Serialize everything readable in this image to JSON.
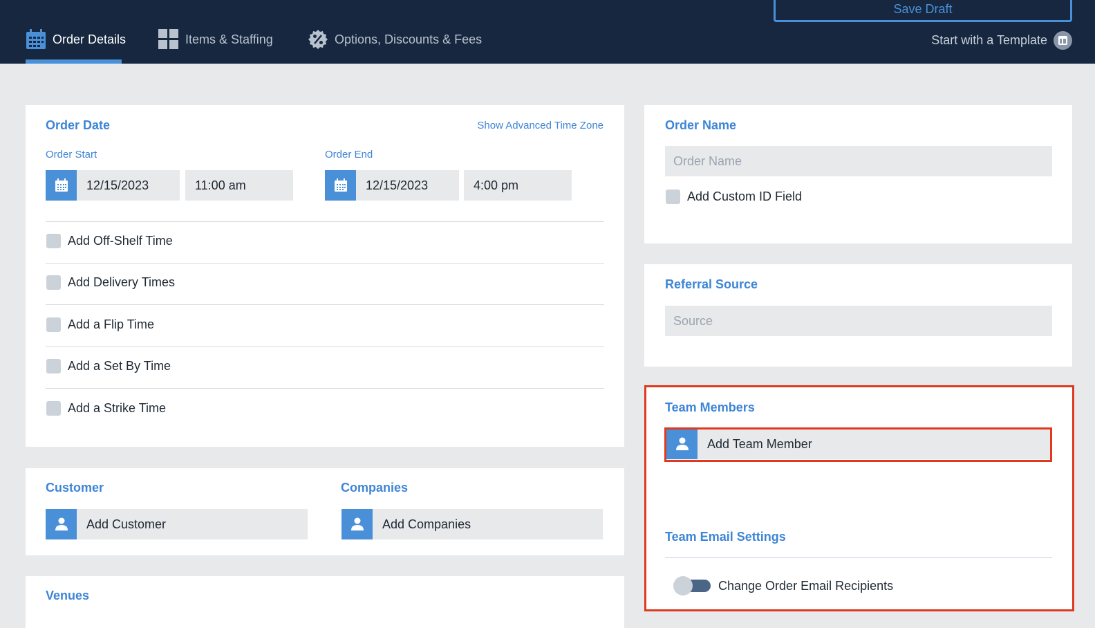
{
  "header": {
    "tabs": [
      {
        "label": "Order Details",
        "icon": "calendar-icon",
        "active": true
      },
      {
        "label": "Items & Staffing",
        "icon": "grid-icon",
        "active": false
      },
      {
        "label": "Options, Discounts & Fees",
        "icon": "discount-badge-icon",
        "active": false
      }
    ],
    "save_draft_label": "Save Draft",
    "template_label": "Start with a Template",
    "template_icon": "template-icon"
  },
  "order_date": {
    "title": "Order Date",
    "advanced_tz_link": "Show Advanced Time Zone",
    "start_label": "Order Start",
    "start_date": "12/15/2023",
    "start_time": "11:00 am",
    "end_label": "Order End",
    "end_date": "12/15/2023",
    "end_time": "4:00 pm",
    "options": [
      "Add Off-Shelf Time",
      "Add Delivery Times",
      "Add a Flip Time",
      "Add a Set By Time",
      "Add a Strike Time"
    ]
  },
  "customer": {
    "title": "Customer",
    "button_label": "Add Customer"
  },
  "companies": {
    "title": "Companies",
    "button_label": "Add Companies"
  },
  "venues": {
    "title": "Venues"
  },
  "order_name": {
    "title": "Order Name",
    "placeholder": "Order Name",
    "custom_id_label": "Add Custom ID Field"
  },
  "referral": {
    "title": "Referral Source",
    "placeholder": "Source"
  },
  "team": {
    "title": "Team Members",
    "add_label": "Add Team Member",
    "email_settings_title": "Team Email Settings",
    "toggle_label": "Change Order Email Recipients",
    "toggle_on": false
  },
  "colors": {
    "header_bg": "#16273f",
    "accent": "#4a90d9",
    "highlight": "#e0391f",
    "page_bg": "#e8e9eb"
  }
}
